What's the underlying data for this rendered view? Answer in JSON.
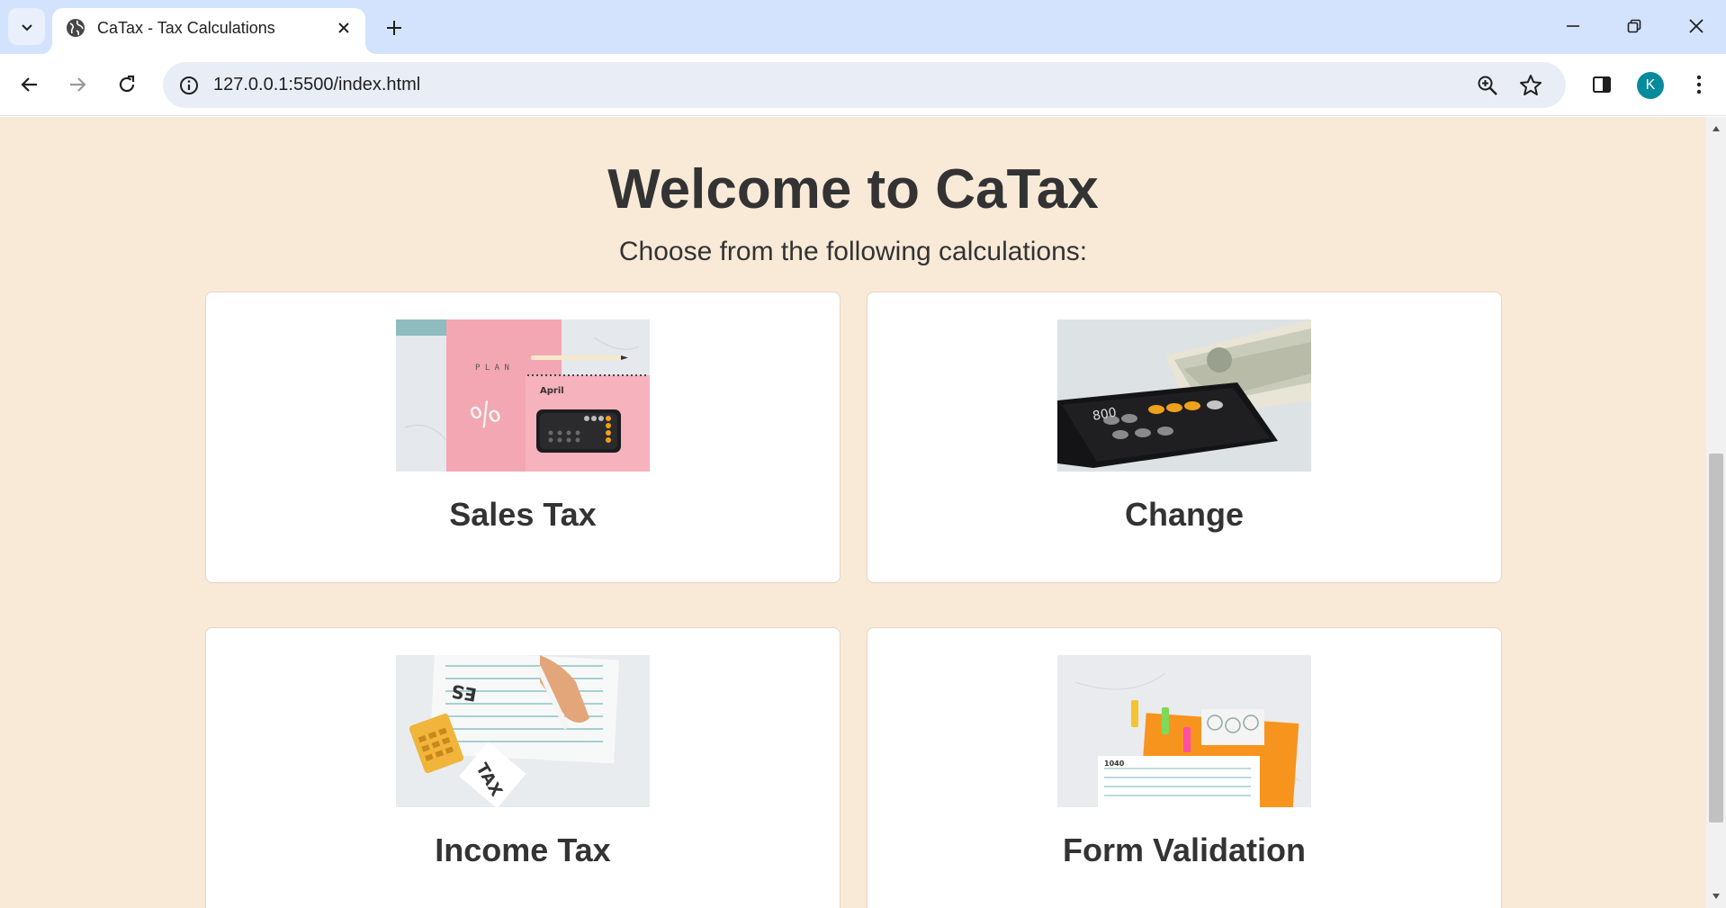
{
  "browser": {
    "tab_title": "CaTax - Tax Calculations",
    "url": "127.0.0.1:5500/index.html",
    "profile_initial": "K"
  },
  "page": {
    "title": "Welcome to CaTax",
    "subtitle": "Choose from the following calculations:",
    "cards": [
      {
        "label": "Sales Tax",
        "image": "calendar-calculator-photo"
      },
      {
        "label": "Change",
        "image": "money-phone-photo"
      },
      {
        "label": "Income Tax",
        "image": "tax-form-writing-photo"
      },
      {
        "label": "Form Validation",
        "image": "tax-forms-folder-photo"
      }
    ]
  },
  "colors": {
    "page_background": "#f9ead8",
    "card_background": "#ffffff",
    "text": "#333333",
    "tabstrip": "#d3e3fd",
    "avatar": "#078b9c"
  }
}
